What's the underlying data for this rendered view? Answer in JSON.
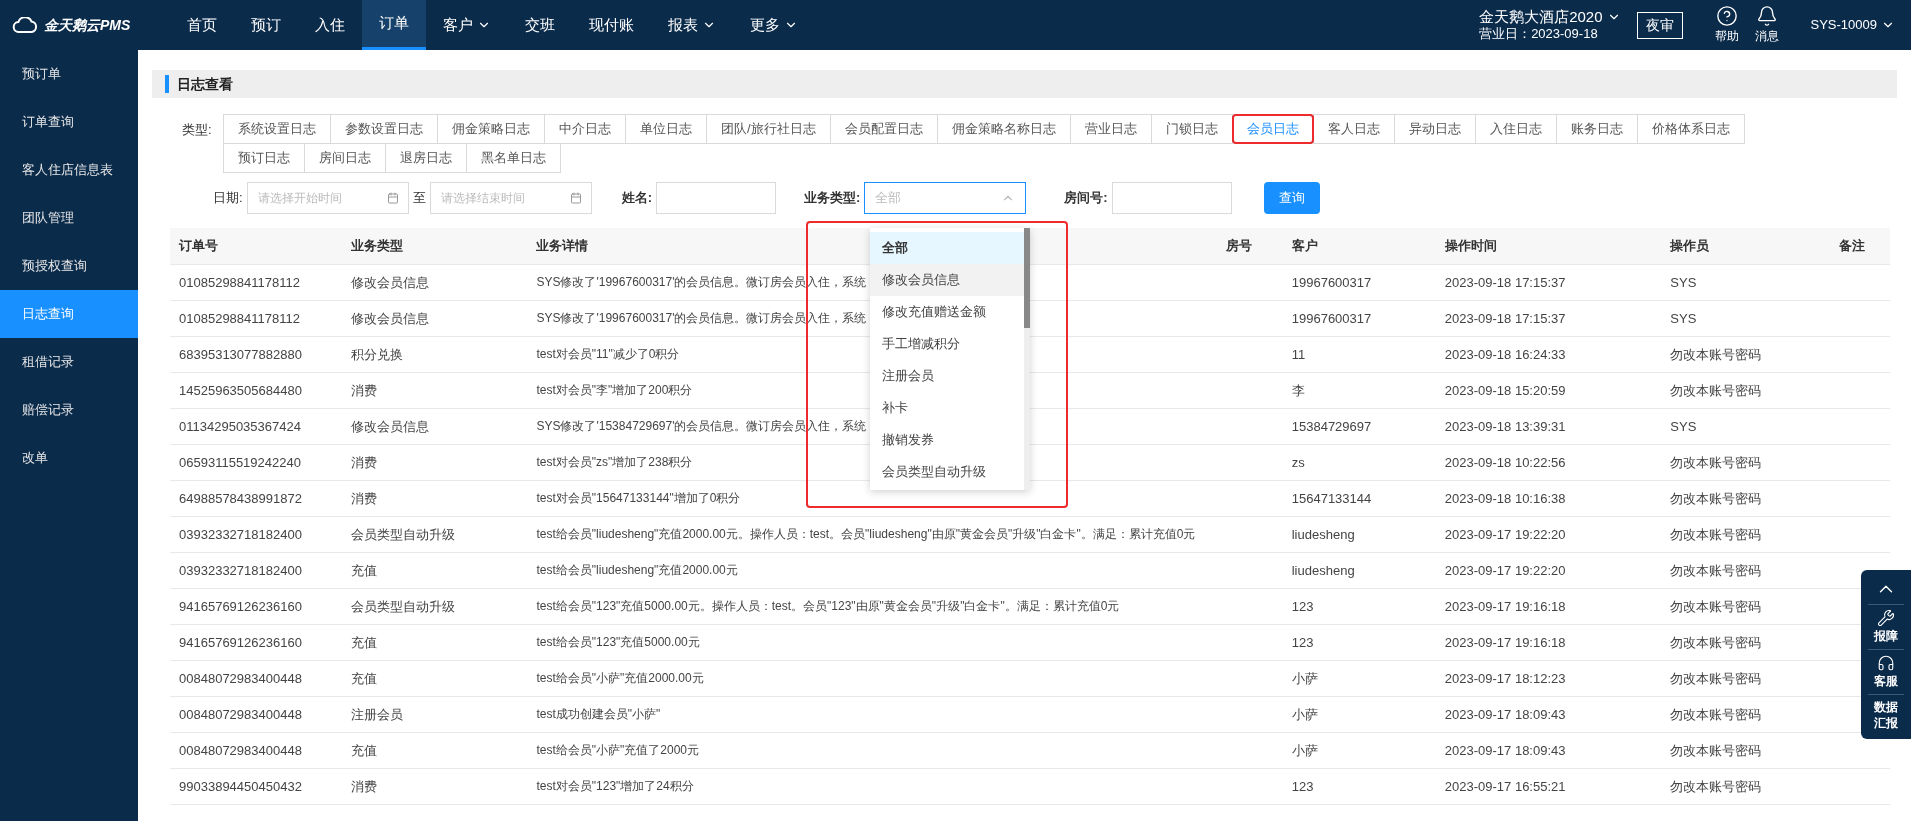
{
  "brand": "金天鹅云PMS",
  "nav": [
    {
      "label": "首页",
      "selected": false,
      "caret": false
    },
    {
      "label": "预订",
      "selected": false,
      "caret": false
    },
    {
      "label": "入住",
      "selected": false,
      "caret": false
    },
    {
      "label": "订单",
      "selected": true,
      "caret": false
    },
    {
      "label": "客户",
      "selected": false,
      "caret": true
    },
    {
      "label": "交班",
      "selected": false,
      "caret": false
    },
    {
      "label": "现付账",
      "selected": false,
      "caret": false
    },
    {
      "label": "报表",
      "selected": false,
      "caret": true
    },
    {
      "label": "更多",
      "selected": false,
      "caret": true
    }
  ],
  "hotel": {
    "name": "金天鹅大酒店2020",
    "business_day": "营业日：2023-09-18"
  },
  "night_audit": "夜审",
  "help": "帮助",
  "messages": "消息",
  "user": "SYS-10009",
  "sidebar": [
    {
      "label": "预订单",
      "selected": false
    },
    {
      "label": "订单查询",
      "selected": false
    },
    {
      "label": "客人住店信息表",
      "selected": false
    },
    {
      "label": "团队管理",
      "selected": false
    },
    {
      "label": "预授权查询",
      "selected": false
    },
    {
      "label": "日志查询",
      "selected": true
    },
    {
      "label": "租借记录",
      "selected": false
    },
    {
      "label": "赔偿记录",
      "selected": false
    },
    {
      "label": "改单",
      "selected": false
    }
  ],
  "section_title": "日志查看",
  "type_label": "类型:",
  "tabs": [
    {
      "label": "系统设置日志",
      "selected": false
    },
    {
      "label": "参数设置日志",
      "selected": false
    },
    {
      "label": "佣金策略日志",
      "selected": false
    },
    {
      "label": "中介日志",
      "selected": false
    },
    {
      "label": "单位日志",
      "selected": false
    },
    {
      "label": "团队/旅行社日志",
      "selected": false
    },
    {
      "label": "会员配置日志",
      "selected": false
    },
    {
      "label": "佣金策略名称日志",
      "selected": false
    },
    {
      "label": "营业日志",
      "selected": false
    },
    {
      "label": "门锁日志",
      "selected": false
    },
    {
      "label": "会员日志",
      "selected": true
    },
    {
      "label": "客人日志",
      "selected": false
    },
    {
      "label": "异动日志",
      "selected": false
    },
    {
      "label": "入住日志",
      "selected": false
    },
    {
      "label": "账务日志",
      "selected": false
    },
    {
      "label": "价格体系日志",
      "selected": false
    },
    {
      "label": "预订日志",
      "selected": false
    },
    {
      "label": "房间日志",
      "selected": false
    },
    {
      "label": "退房日志",
      "selected": false
    },
    {
      "label": "黑名单日志",
      "selected": false
    }
  ],
  "filters": {
    "date_label": "日期:",
    "start_placeholder": "请选择开始时间",
    "to": "至",
    "end_placeholder": "请选择结束时间",
    "name_label": "姓名:",
    "type_label": "业务类型:",
    "type_value": "全部",
    "room_label": "房间号:",
    "query_button": "查询"
  },
  "dropdown": {
    "options": [
      {
        "label": "全部",
        "selected": true,
        "hovered": false
      },
      {
        "label": "修改会员信息",
        "selected": false,
        "hovered": true
      },
      {
        "label": "修改充值赠送金额",
        "selected": false,
        "hovered": false
      },
      {
        "label": "手工增减积分",
        "selected": false,
        "hovered": false
      },
      {
        "label": "注册会员",
        "selected": false,
        "hovered": false
      },
      {
        "label": "补卡",
        "selected": false,
        "hovered": false
      },
      {
        "label": "撤销发券",
        "selected": false,
        "hovered": false
      },
      {
        "label": "会员类型自动升级",
        "selected": false,
        "hovered": false
      }
    ]
  },
  "table": {
    "columns": [
      "订单号",
      "业务类型",
      "业务详情",
      "房号",
      "客户",
      "操作时间",
      "操作员",
      "备注"
    ],
    "rows": [
      [
        "01085298841178112",
        "修改会员信息",
        "SYS修改了'19967600317'的会员信息。微订房会员入住，系统",
        "",
        "19967600317",
        "2023-09-18 17:15:37",
        "SYS",
        ""
      ],
      [
        "01085298841178112",
        "修改会员信息",
        "SYS修改了'19967600317'的会员信息。微订房会员入住，系统",
        "",
        "19967600317",
        "2023-09-18 17:15:37",
        "SYS",
        ""
      ],
      [
        "68395313077882880",
        "积分兑换",
        "test对会员\"11\"减少了0积分",
        "",
        "11",
        "2023-09-18 16:24:33",
        "勿改本账号密码",
        ""
      ],
      [
        "14525963505684480",
        "消费",
        "test对会员\"李\"增加了200积分",
        "",
        "李",
        "2023-09-18 15:20:59",
        "勿改本账号密码",
        ""
      ],
      [
        "01134295035367424",
        "修改会员信息",
        "SYS修改了'15384729697'的会员信息。微订房会员入住，系统",
        "",
        "15384729697",
        "2023-09-18 13:39:31",
        "SYS",
        ""
      ],
      [
        "06593115519242240",
        "消费",
        "test对会员\"zs\"增加了238积分",
        "",
        "zs",
        "2023-09-18 10:22:56",
        "勿改本账号密码",
        ""
      ],
      [
        "64988578438991872",
        "消费",
        "test对会员\"15647133144\"增加了0积分",
        "",
        "15647133144",
        "2023-09-18 10:16:38",
        "勿改本账号密码",
        ""
      ],
      [
        "03932332718182400",
        "会员类型自动升级",
        "test给会员\"liudesheng\"充值2000.00元。操作人员：test。会员\"liudesheng\"由原\"黄金会员\"升级\"白金卡\"。满足：累计充值0元",
        "",
        "liudesheng",
        "2023-09-17 19:22:20",
        "勿改本账号密码",
        ""
      ],
      [
        "03932332718182400",
        "充值",
        "test给会员\"liudesheng\"充值2000.00元",
        "",
        "liudesheng",
        "2023-09-17 19:22:20",
        "勿改本账号密码",
        ""
      ],
      [
        "94165769126236160",
        "会员类型自动升级",
        "test给会员\"123\"充值5000.00元。操作人员：test。会员\"123\"由原\"黄金会员\"升级\"白金卡\"。满足：累计充值0元",
        "",
        "123",
        "2023-09-17 19:16:18",
        "勿改本账号密码",
        ""
      ],
      [
        "94165769126236160",
        "充值",
        "test给会员\"123\"充值5000.00元",
        "",
        "123",
        "2023-09-17 19:16:18",
        "勿改本账号密码",
        ""
      ],
      [
        "00848072983400448",
        "充值",
        "test给会员\"小萨\"充值2000.00元",
        "",
        "小萨",
        "2023-09-17 18:12:23",
        "勿改本账号密码",
        ""
      ],
      [
        "00848072983400448",
        "注册会员",
        "test成功创建会员\"小萨\"",
        "",
        "小萨",
        "2023-09-17 18:09:43",
        "勿改本账号密码",
        ""
      ],
      [
        "00848072983400448",
        "充值",
        "test给会员\"小萨\"充值了2000元",
        "",
        "小萨",
        "2023-09-17 18:09:43",
        "勿改本账号密码",
        ""
      ],
      [
        "99033894450450432",
        "消费",
        "test对会员\"123\"增加了24积分",
        "",
        "123",
        "2023-09-17 16:55:21",
        "勿改本账号密码",
        ""
      ]
    ]
  },
  "float_panel": {
    "report": "报障",
    "service": "客服",
    "data": "数据汇报"
  }
}
